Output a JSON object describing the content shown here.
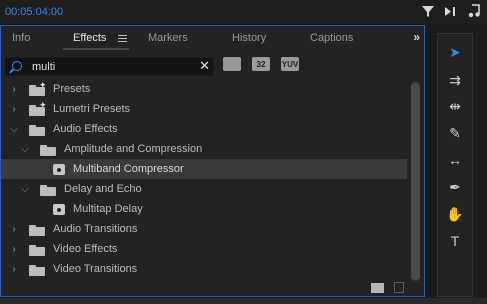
{
  "header": {
    "timecode": "00:05:04:00",
    "icons": [
      "funnel-icon",
      "play-in-icon",
      "music-note-icon"
    ]
  },
  "panel": {
    "tabs": [
      {
        "label": "Info",
        "active": false
      },
      {
        "label": "Effects",
        "active": true
      },
      {
        "label": "Markers",
        "active": false
      },
      {
        "label": "History",
        "active": false
      },
      {
        "label": "Captions",
        "active": false
      }
    ],
    "overflow": "»",
    "search": {
      "value": "multi",
      "placeholder": ""
    },
    "filters": [
      "",
      "32",
      "YUV"
    ],
    "tree": [
      {
        "label": "Presets",
        "level": 0,
        "type": "star-folder",
        "expanded": false,
        "selected": false
      },
      {
        "label": "Lumetri Presets",
        "level": 0,
        "type": "star-folder",
        "expanded": false,
        "selected": false
      },
      {
        "label": "Audio Effects",
        "level": 0,
        "type": "folder",
        "expanded": true,
        "selected": false
      },
      {
        "label": "Amplitude and Compression",
        "level": 1,
        "type": "folder",
        "expanded": true,
        "selected": false
      },
      {
        "label": "Multiband Compressor",
        "level": 2,
        "type": "effect",
        "expanded": false,
        "selected": true
      },
      {
        "label": "Delay and Echo",
        "level": 1,
        "type": "folder",
        "expanded": true,
        "selected": false
      },
      {
        "label": "Multitap Delay",
        "level": 2,
        "type": "effect",
        "expanded": false,
        "selected": false
      },
      {
        "label": "Audio Transitions",
        "level": 0,
        "type": "folder",
        "expanded": false,
        "selected": false
      },
      {
        "label": "Video Effects",
        "level": 0,
        "type": "folder",
        "expanded": false,
        "selected": false
      },
      {
        "label": "Video Transitions",
        "level": 0,
        "type": "folder",
        "expanded": false,
        "selected": false
      }
    ]
  },
  "tools": [
    {
      "name": "selection-tool-icon",
      "glyph": "➤",
      "active": true
    },
    {
      "name": "track-select-tool-icon",
      "glyph": "⇉",
      "active": false
    },
    {
      "name": "ripple-edit-tool-icon",
      "glyph": "⇹",
      "active": false
    },
    {
      "name": "razor-tool-icon",
      "glyph": "✎",
      "active": false
    },
    {
      "name": "slip-tool-icon",
      "glyph": "↔",
      "active": false
    },
    {
      "name": "pen-tool-icon",
      "glyph": "✒",
      "active": false
    },
    {
      "name": "hand-tool-icon",
      "glyph": "✋",
      "active": false
    },
    {
      "name": "type-tool-icon",
      "glyph": "T",
      "active": false
    }
  ],
  "colors": {
    "accent": "#2d8ceb",
    "panel_bg": "#232323",
    "selected_row": "#3a3a3a",
    "focus_border": "#2d5fb6"
  }
}
